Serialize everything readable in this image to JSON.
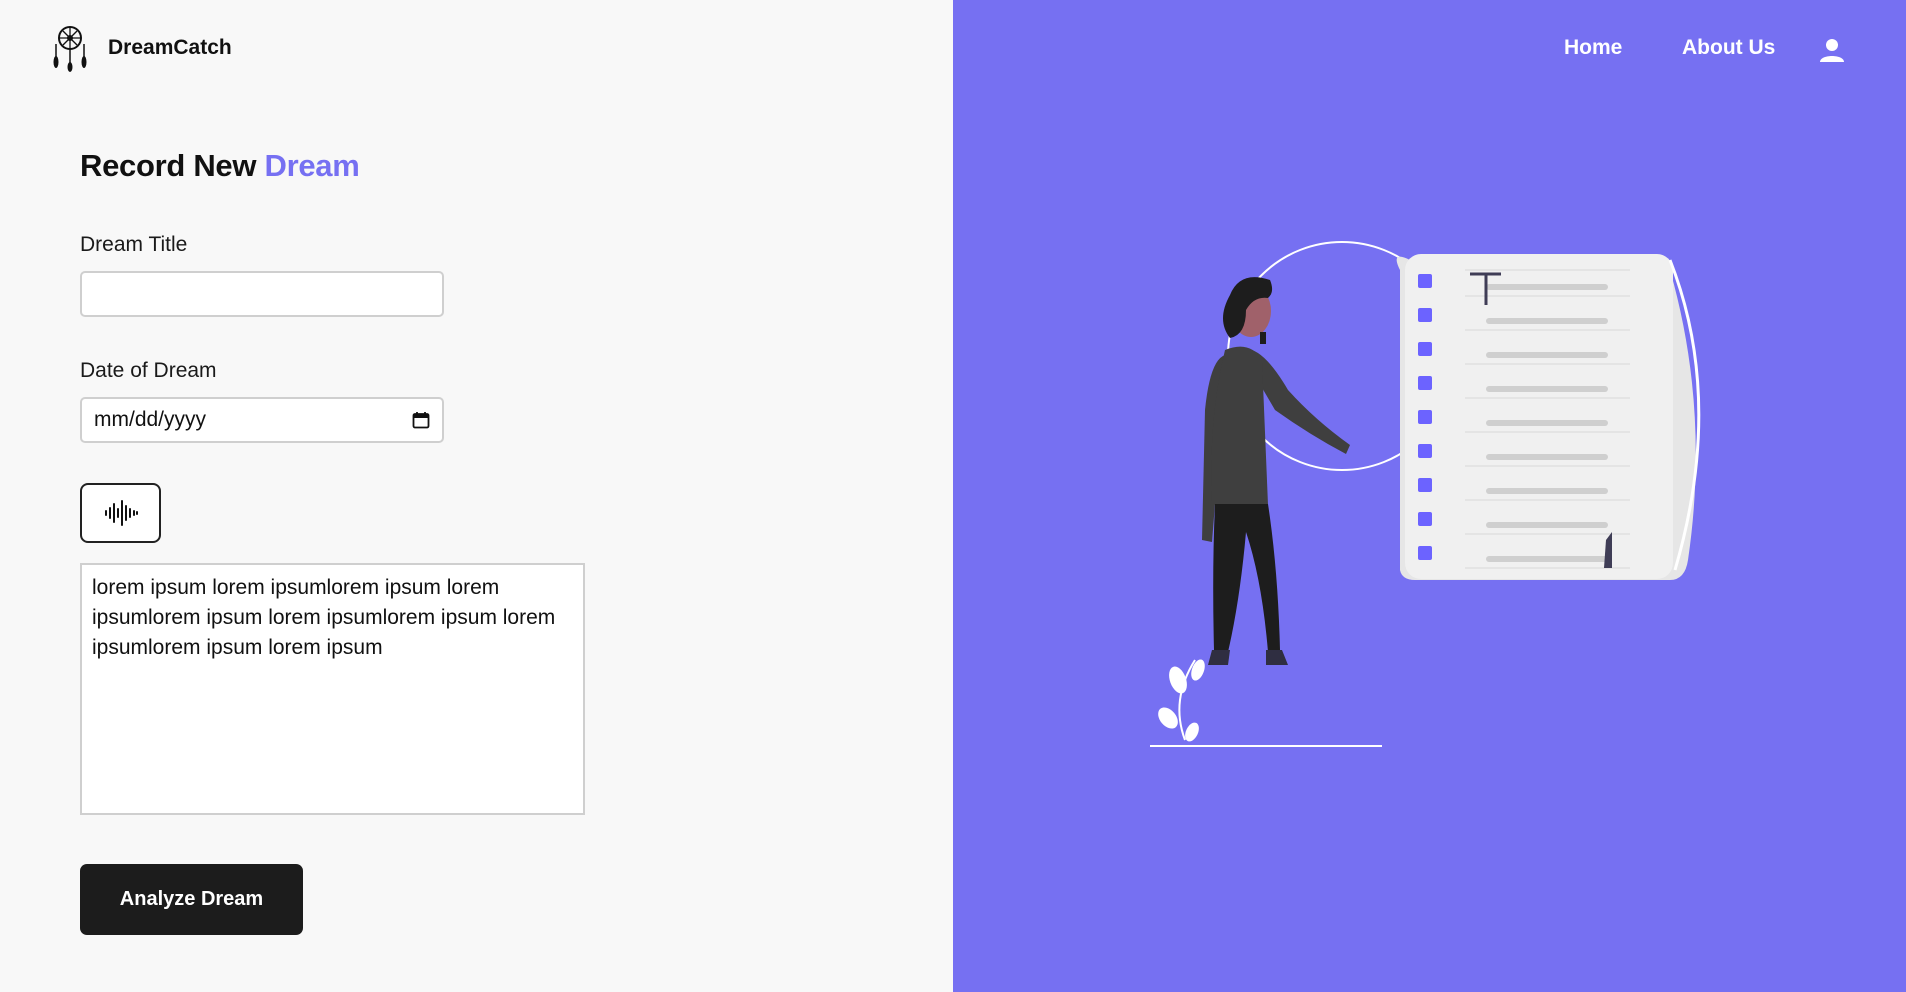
{
  "brand": {
    "name": "DreamCatch",
    "logo_icon": "dreamcatcher-icon"
  },
  "nav": {
    "home": "Home",
    "about": "About Us",
    "user_icon": "user-icon"
  },
  "form": {
    "title_part1": "Record New",
    "title_part2": "Dream",
    "title_label": "Dream Title",
    "title_value": "",
    "date_label": "Date of Dream",
    "date_value": "mm/dd/yyyy",
    "record_icon": "soundwave-icon",
    "dream_text": "lorem ipsum lorem ipsumlorem ipsum lorem ipsumlorem ipsum lorem ipsumlorem ipsum lorem ipsumlorem ipsum lorem ipsum",
    "submit_label": "Analyze Dream"
  },
  "colors": {
    "accent": "#7670f2",
    "dark_button": "#1c1c1c",
    "page_bg": "#f8f8f8"
  }
}
